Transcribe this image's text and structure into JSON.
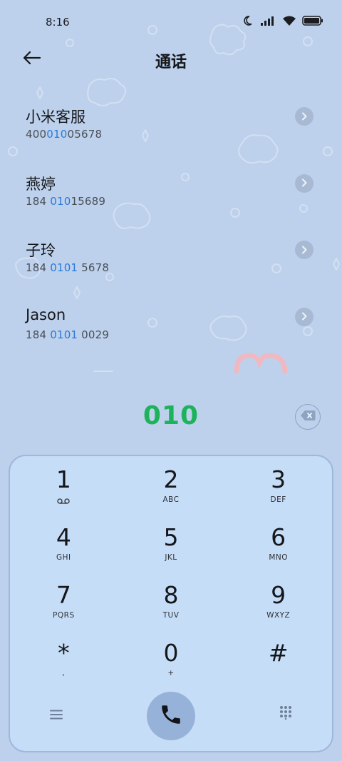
{
  "status_bar": {
    "time": "8:16"
  },
  "header": {
    "title": "通话"
  },
  "contacts": [
    {
      "name": "小米客服",
      "number_pre": "400",
      "number_match": "010",
      "number_post": "05678"
    },
    {
      "name": "燕婷",
      "number_pre": "184 ",
      "number_match": "010",
      "number_post": "15689"
    },
    {
      "name": "子玲",
      "number_pre": "184 ",
      "number_match": "0101",
      "number_post": " 5678"
    },
    {
      "name": "Jason",
      "number_pre": "184 ",
      "number_match": "0101",
      "number_post": " 0029"
    }
  ],
  "dial": {
    "number": "010"
  },
  "keypad": [
    {
      "digit": "1",
      "letters": "",
      "icon": "voicemail-icon"
    },
    {
      "digit": "2",
      "letters": "ABC"
    },
    {
      "digit": "3",
      "letters": "DEF"
    },
    {
      "digit": "4",
      "letters": "GHI"
    },
    {
      "digit": "5",
      "letters": "JKL"
    },
    {
      "digit": "6",
      "letters": "MNO"
    },
    {
      "digit": "7",
      "letters": "PQRS"
    },
    {
      "digit": "8",
      "letters": "TUV"
    },
    {
      "digit": "9",
      "letters": "WXYZ"
    },
    {
      "digit": "*",
      "letters": ","
    },
    {
      "digit": "0",
      "letters": "+"
    },
    {
      "digit": "#",
      "letters": ""
    }
  ],
  "colors": {
    "background": "#bdd1ec",
    "keypad_bg": "#c6ddf7",
    "match_highlight": "#2a7ad8",
    "dial_number": "#1db35a",
    "call_button": "#97b2d8"
  }
}
